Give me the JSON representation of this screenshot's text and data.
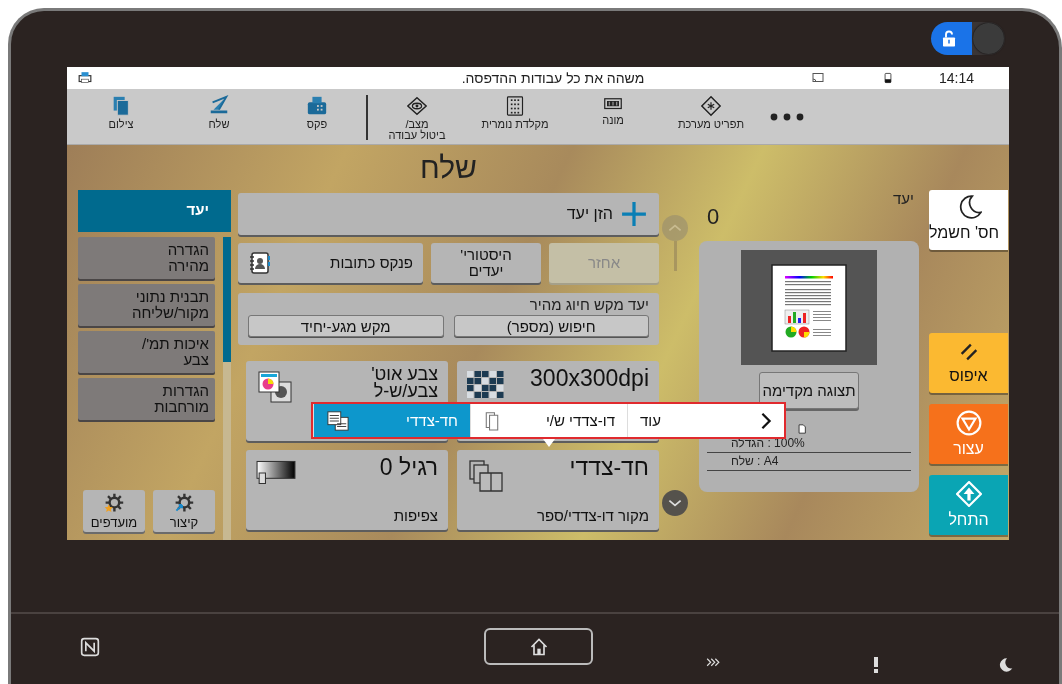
{
  "lock_toggle": {
    "on": true
  },
  "status_bar": {
    "message": "משהה את כל עבודות ההדפסה.",
    "time": "14:14"
  },
  "toolbar": {
    "items": [
      {
        "label": "תפריט מערכת",
        "kind": "system"
      },
      {
        "label": "מונה",
        "kind": "counter"
      },
      {
        "label": "מקלדת נומרית",
        "kind": "keypad"
      },
      {
        "label": "מצב/\nביטול עבודה",
        "kind": "status"
      },
      {
        "label": "פקס",
        "kind": "fax"
      },
      {
        "label": "שלח",
        "kind": "send"
      },
      {
        "label": "צילום",
        "kind": "copy"
      }
    ]
  },
  "title": "שלח",
  "sidebar": {
    "tabs": [
      {
        "label": "יעד",
        "selected": true
      },
      {
        "label": "הגדרה\nמהירה",
        "selected": false
      },
      {
        "label": "תבנית נתוני\nמקור/שליחה",
        "selected": false
      },
      {
        "label": "איכות תמ'/\nצבע",
        "selected": false
      },
      {
        "label": "הגדרות\nמורחבות",
        "selected": false
      }
    ],
    "buttons": [
      {
        "label": "קיצור",
        "kind": "shortcut"
      },
      {
        "label": "מועדפים",
        "kind": "favorites"
      }
    ]
  },
  "destination": {
    "enter_button": "הזן יעד",
    "buttons": [
      {
        "label": "אחזר",
        "disabled": true
      },
      {
        "label": "היסטורי'\nיעדים",
        "disabled": false
      },
      {
        "label": "פנקס כתובות",
        "disabled": false
      }
    ],
    "quick_dial": {
      "title": "יעד מקש חיוג מהיר",
      "buttons": [
        "חיפוש (מספר)",
        "מקש מגע-יחיד"
      ]
    }
  },
  "tiles": [
    {
      "value": "300x300dpi",
      "kind": "resolution"
    },
    {
      "value": "צבע אוט'\nצבע/ש-ל",
      "kind": "color"
    },
    {
      "value": "חד-צדדי",
      "sub": "מקור דו-צדדי/ספר",
      "kind": "duplex"
    },
    {
      "value": "רגיל 0",
      "sub": "צפיפות",
      "kind": "density"
    }
  ],
  "popup": {
    "options": [
      {
        "label": "עוד",
        "kind": "more",
        "selected": false
      },
      {
        "label": "דו-צדדי ש/י",
        "kind": "duplex",
        "selected": false
      },
      {
        "label": "חד-צדדי",
        "kind": "simplex",
        "selected": true
      }
    ]
  },
  "summary": {
    "label": "יעד",
    "count": "0",
    "preview_button": "תצוגה מקדימה",
    "rows": [
      "100% : הגדלה",
      "A4 : שלח"
    ]
  },
  "side_buttons": [
    {
      "label": "חס' חשמל",
      "kind": "energy"
    },
    {
      "label": "איפוס",
      "kind": "reset"
    },
    {
      "label": "עצור",
      "kind": "stop"
    },
    {
      "label": "התחל",
      "kind": "start"
    }
  ]
}
